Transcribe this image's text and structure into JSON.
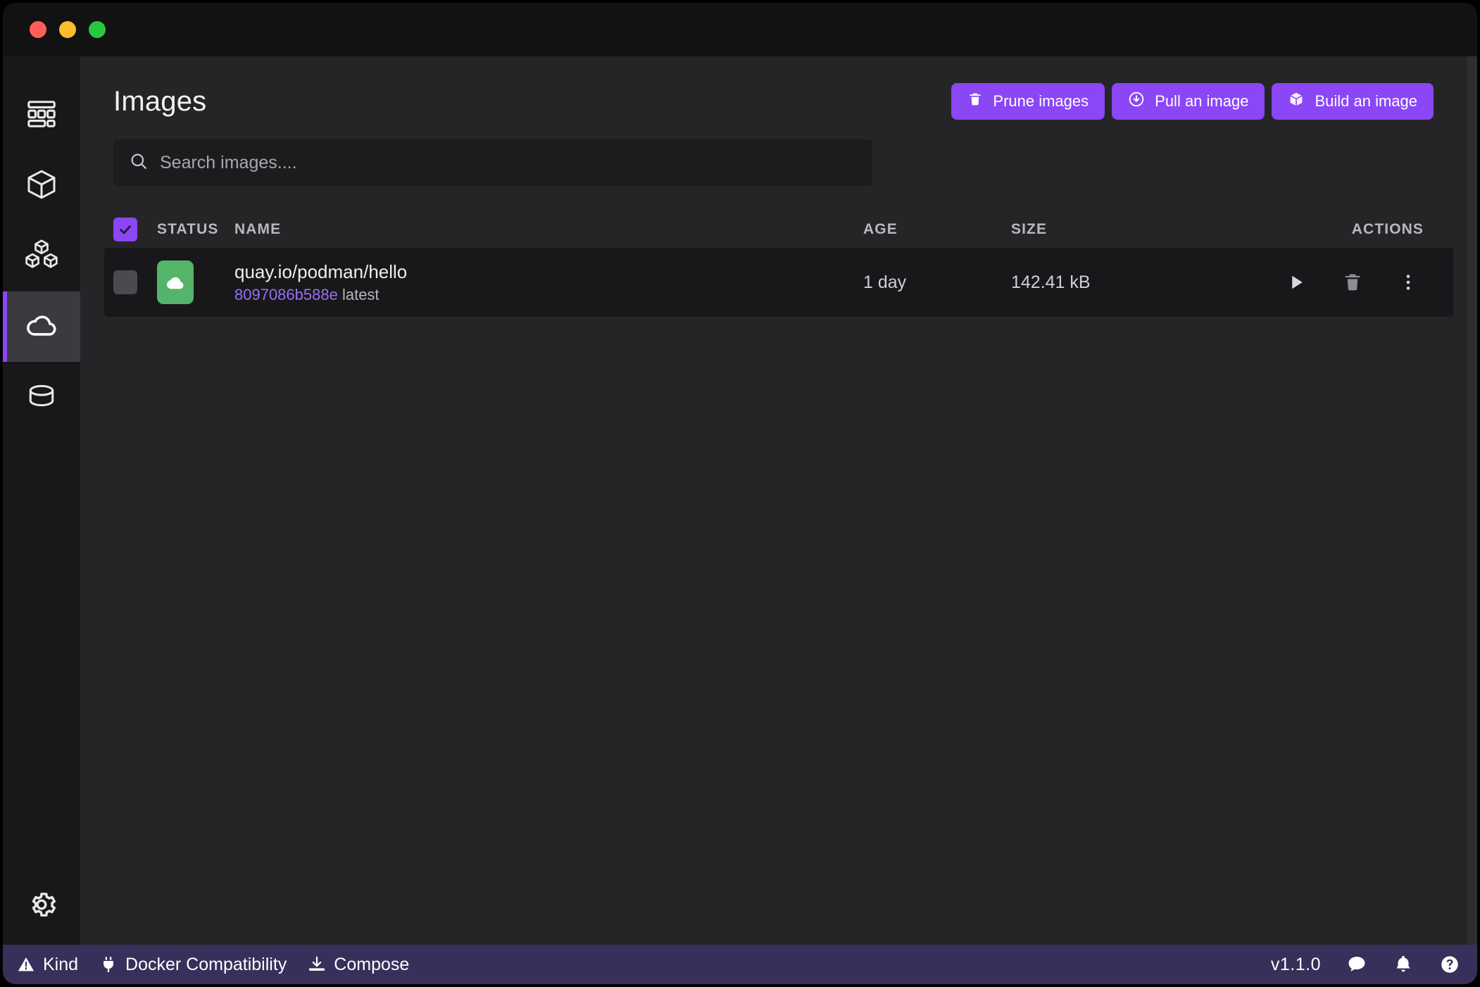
{
  "window": {
    "traffic_lights": [
      {
        "name": "close",
        "color": "#ff5f57"
      },
      {
        "name": "minimize",
        "color": "#febc2e"
      },
      {
        "name": "maximize",
        "color": "#28c840"
      }
    ]
  },
  "colors": {
    "accent": "#8b46f5",
    "accent_soft": "#9a6ef0",
    "page_bg": "#252527",
    "sidebar_bg": "#18181b",
    "row_bg": "#18181b",
    "titlebar_bg": "#121213",
    "statusbar_bg": "#382f5a",
    "image_badge_green": "#53b46a"
  },
  "sidebar": {
    "items": [
      {
        "icon": "dashboard-icon",
        "label": "Dashboard",
        "active": false
      },
      {
        "icon": "cube-icon",
        "label": "Containers",
        "active": false
      },
      {
        "icon": "pods-icon",
        "label": "Pods",
        "active": false
      },
      {
        "icon": "cloud-icon",
        "label": "Images",
        "active": true
      },
      {
        "icon": "database-icon",
        "label": "Volumes",
        "active": false
      }
    ],
    "bottom": {
      "icon": "gear-icon",
      "label": "Settings"
    }
  },
  "header": {
    "title": "Images",
    "buttons": [
      {
        "icon": "trash-icon",
        "label": "Prune images"
      },
      {
        "icon": "download-circle-icon",
        "label": "Pull an image"
      },
      {
        "icon": "cube-icon",
        "label": "Build an image"
      }
    ]
  },
  "search": {
    "icon": "search-icon",
    "placeholder": "Search images....",
    "value": ""
  },
  "table": {
    "select_all_checked": true,
    "columns": {
      "status": "STATUS",
      "name": "NAME",
      "age": "AGE",
      "size": "SIZE",
      "actions": "ACTIONS"
    },
    "rows": [
      {
        "selected": false,
        "status_icon": "cloud-image-icon",
        "name": "quay.io/podman/hello",
        "image_id": "8097086b588e",
        "tag": "latest",
        "age": "1 day",
        "size": "142.41 kB",
        "actions": [
          {
            "icon": "play-icon",
            "label": "Run image"
          },
          {
            "icon": "trash-icon",
            "label": "Delete image"
          },
          {
            "icon": "kebab-menu-icon",
            "label": "More options"
          }
        ]
      }
    ]
  },
  "statusbar": {
    "left": [
      {
        "icon": "warning-triangle-icon",
        "label": "Kind"
      },
      {
        "icon": "plug-icon",
        "label": "Docker Compatibility"
      },
      {
        "icon": "download-icon",
        "label": "Compose"
      }
    ],
    "version": "v1.1.0",
    "right_icons": [
      {
        "icon": "chat-bubble-icon",
        "label": "Feedback"
      },
      {
        "icon": "bell-icon",
        "label": "Notifications"
      },
      {
        "icon": "help-circle-icon",
        "label": "Help"
      }
    ]
  }
}
